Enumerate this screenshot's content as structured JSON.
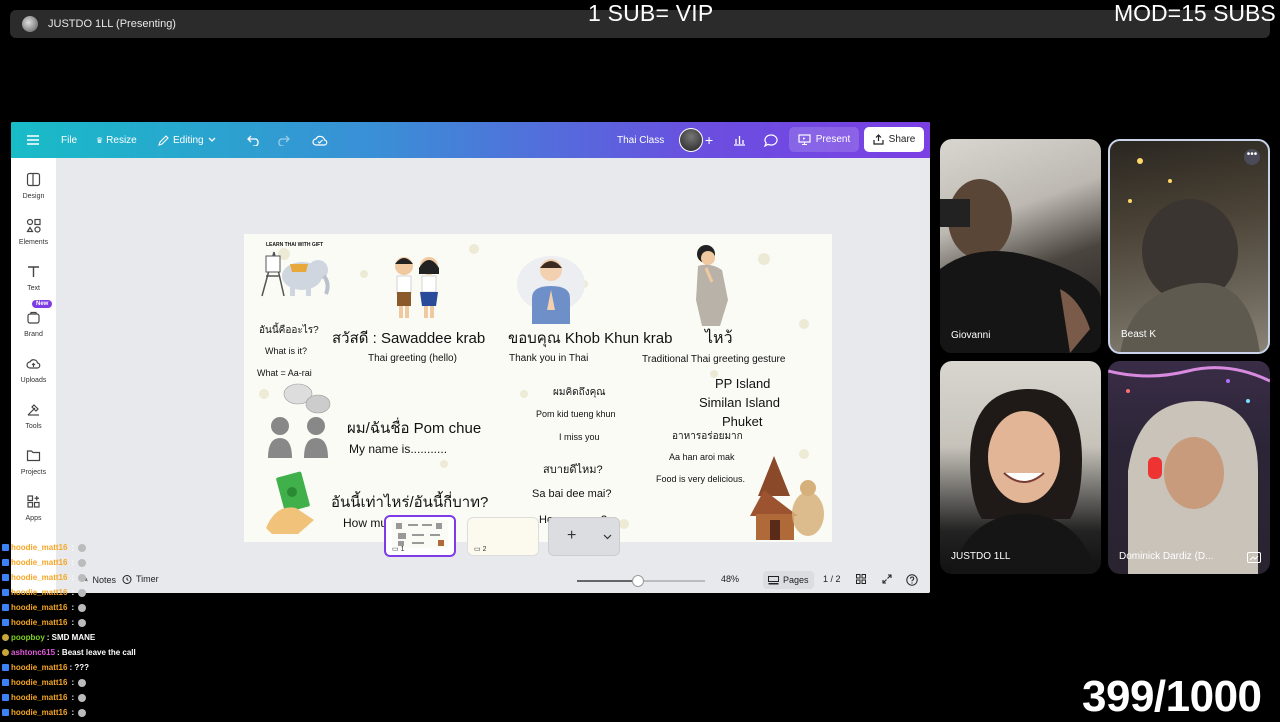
{
  "meeting": {
    "presenter_title": "JUSTDO 1LL (Presenting)"
  },
  "overlays": {
    "sub_text": "1 SUB= VIP",
    "mod_text": "MOD=15 SUBS",
    "counter": "399/1000"
  },
  "canva": {
    "topbar": {
      "file": "File",
      "resize": "Resize",
      "editing": "Editing",
      "project_name": "Thai Class",
      "present": "Present",
      "share": "Share"
    },
    "sidebar": [
      {
        "label": "Design",
        "icon": "design-icon"
      },
      {
        "label": "Elements",
        "icon": "elements-icon"
      },
      {
        "label": "Text",
        "icon": "text-icon"
      },
      {
        "label": "Brand",
        "icon": "brand-icon"
      },
      {
        "label": "Uploads",
        "icon": "uploads-icon"
      },
      {
        "label": "Tools",
        "icon": "tools-icon"
      },
      {
        "label": "Projects",
        "icon": "projects-icon"
      },
      {
        "label": "Apps",
        "icon": "apps-icon"
      }
    ],
    "new_badge": "New",
    "slide": {
      "logo_text": "LEARN THAI WITH GIFT",
      "q1_thai": "อันนี้คืออะไร?",
      "q1_en": "What is it?",
      "q1_roman": "What = Aa-rai",
      "greeting_line": "สวัสดี : Sawaddee krab",
      "greeting_sub": "Thai greeting (hello)",
      "thanks_line": "ขอบคุณ  Khob Khun krab",
      "thanks_sub": "Thank you in Thai",
      "wai_line": "ไหว้",
      "wai_sub": "Traditional Thai greeting gesture",
      "miss_thai": "ผมคิดถึงคุณ",
      "miss_roman": "Pom kid tueng khun",
      "miss_en": "I miss you",
      "places": [
        "PP Island",
        "Similan Island",
        "Phuket"
      ],
      "name_line": "ผม/ฉันชื่อ  Pom chue",
      "name_sub": "My name is...........",
      "food_thai": "อาหารอร่อยมาก",
      "food_roman": "Aa han aroi mak",
      "food_en": "Food is very delicious.",
      "how_thai": "สบายดีไหม?",
      "how_roman": "Sa bai dee mai?",
      "how_en": "How are you?",
      "price_line": "อันนี้เท่าไหร่/อันนี้กี่บาท?",
      "price_sub": "How much is it?"
    },
    "pages_strip": {
      "page1": "1",
      "page2": "2"
    },
    "bottom": {
      "notes": "Notes",
      "timer": "Timer",
      "zoom": "48%",
      "pages": "Pages",
      "page_indicator": "1 / 2",
      "zoom_value": 0.48
    }
  },
  "participants": [
    {
      "name": "Giovanni"
    },
    {
      "name": "Beast K"
    },
    {
      "name": "JUSTDO 1LL"
    },
    {
      "name": "Dominick Dardiz (D..."
    }
  ],
  "chat": [
    {
      "user": "hoodie_matt16",
      "msg": "",
      "color": "#f5a623"
    },
    {
      "user": "hoodie_matt16",
      "msg": "",
      "color": "#f5a623"
    },
    {
      "user": "hoodie_matt16",
      "msg": "",
      "color": "#f5a623"
    },
    {
      "user": "hoodie_matt16",
      "msg": "",
      "color": "#f5a623"
    },
    {
      "user": "hoodie_matt16",
      "msg": "",
      "color": "#f5a623"
    },
    {
      "user": "hoodie_matt16",
      "msg": "",
      "color": "#f5a623"
    },
    {
      "user": "poopboy",
      "msg": ": SMD MANE",
      "color": "#7ed321"
    },
    {
      "user": "ashtonc615",
      "msg": ": Beast leave the call",
      "color": "#e05ad8"
    },
    {
      "user": "hoodie_matt16",
      "msg": ": ???",
      "color": "#f5a623"
    },
    {
      "user": "hoodie_matt16",
      "msg": "",
      "color": "#f5a623"
    },
    {
      "user": "hoodie_matt16",
      "msg": "",
      "color": "#f5a623"
    },
    {
      "user": "hoodie_matt16",
      "msg": "",
      "color": "#f5a623"
    }
  ]
}
